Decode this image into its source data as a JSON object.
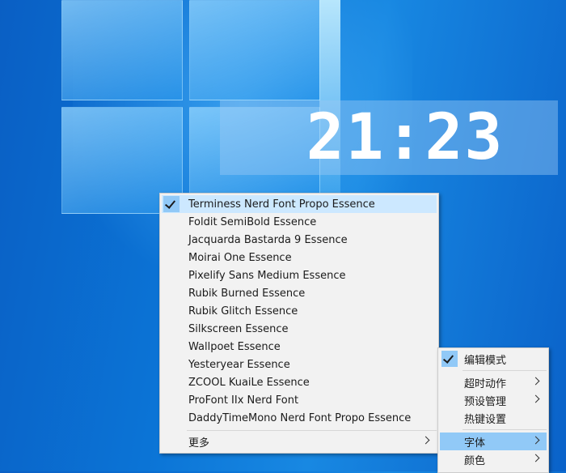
{
  "clock": {
    "time": "21:23"
  },
  "font_menu": {
    "items": [
      {
        "label": "Terminess Nerd Font Propo Essence",
        "checked": true
      },
      {
        "label": "Foldit SemiBold Essence"
      },
      {
        "label": "Jacquarda Bastarda 9 Essence"
      },
      {
        "label": "Moirai One Essence"
      },
      {
        "label": "Pixelify Sans Medium Essence"
      },
      {
        "label": "Rubik Burned Essence"
      },
      {
        "label": "Rubik Glitch Essence"
      },
      {
        "label": "Silkscreen Essence"
      },
      {
        "label": "Wallpoet Essence"
      },
      {
        "label": "Yesteryear Essence"
      },
      {
        "label": "ZCOOL KuaiLe Essence"
      },
      {
        "label": "ProFont IIx Nerd Font"
      },
      {
        "label": "DaddyTimeMono Nerd Font Propo Essence"
      }
    ],
    "more_label": "更多"
  },
  "context_menu": {
    "edit_mode": "编辑模式",
    "timeout_action": "超时动作",
    "preset_manage": "预设管理",
    "hotkey_settings": "热键设置",
    "font": "字体",
    "color": "颜色"
  },
  "colors": {
    "menu_bg": "#f2f2f2",
    "highlight": "#91c9f7",
    "desktop_blue": "#0b74d6"
  }
}
